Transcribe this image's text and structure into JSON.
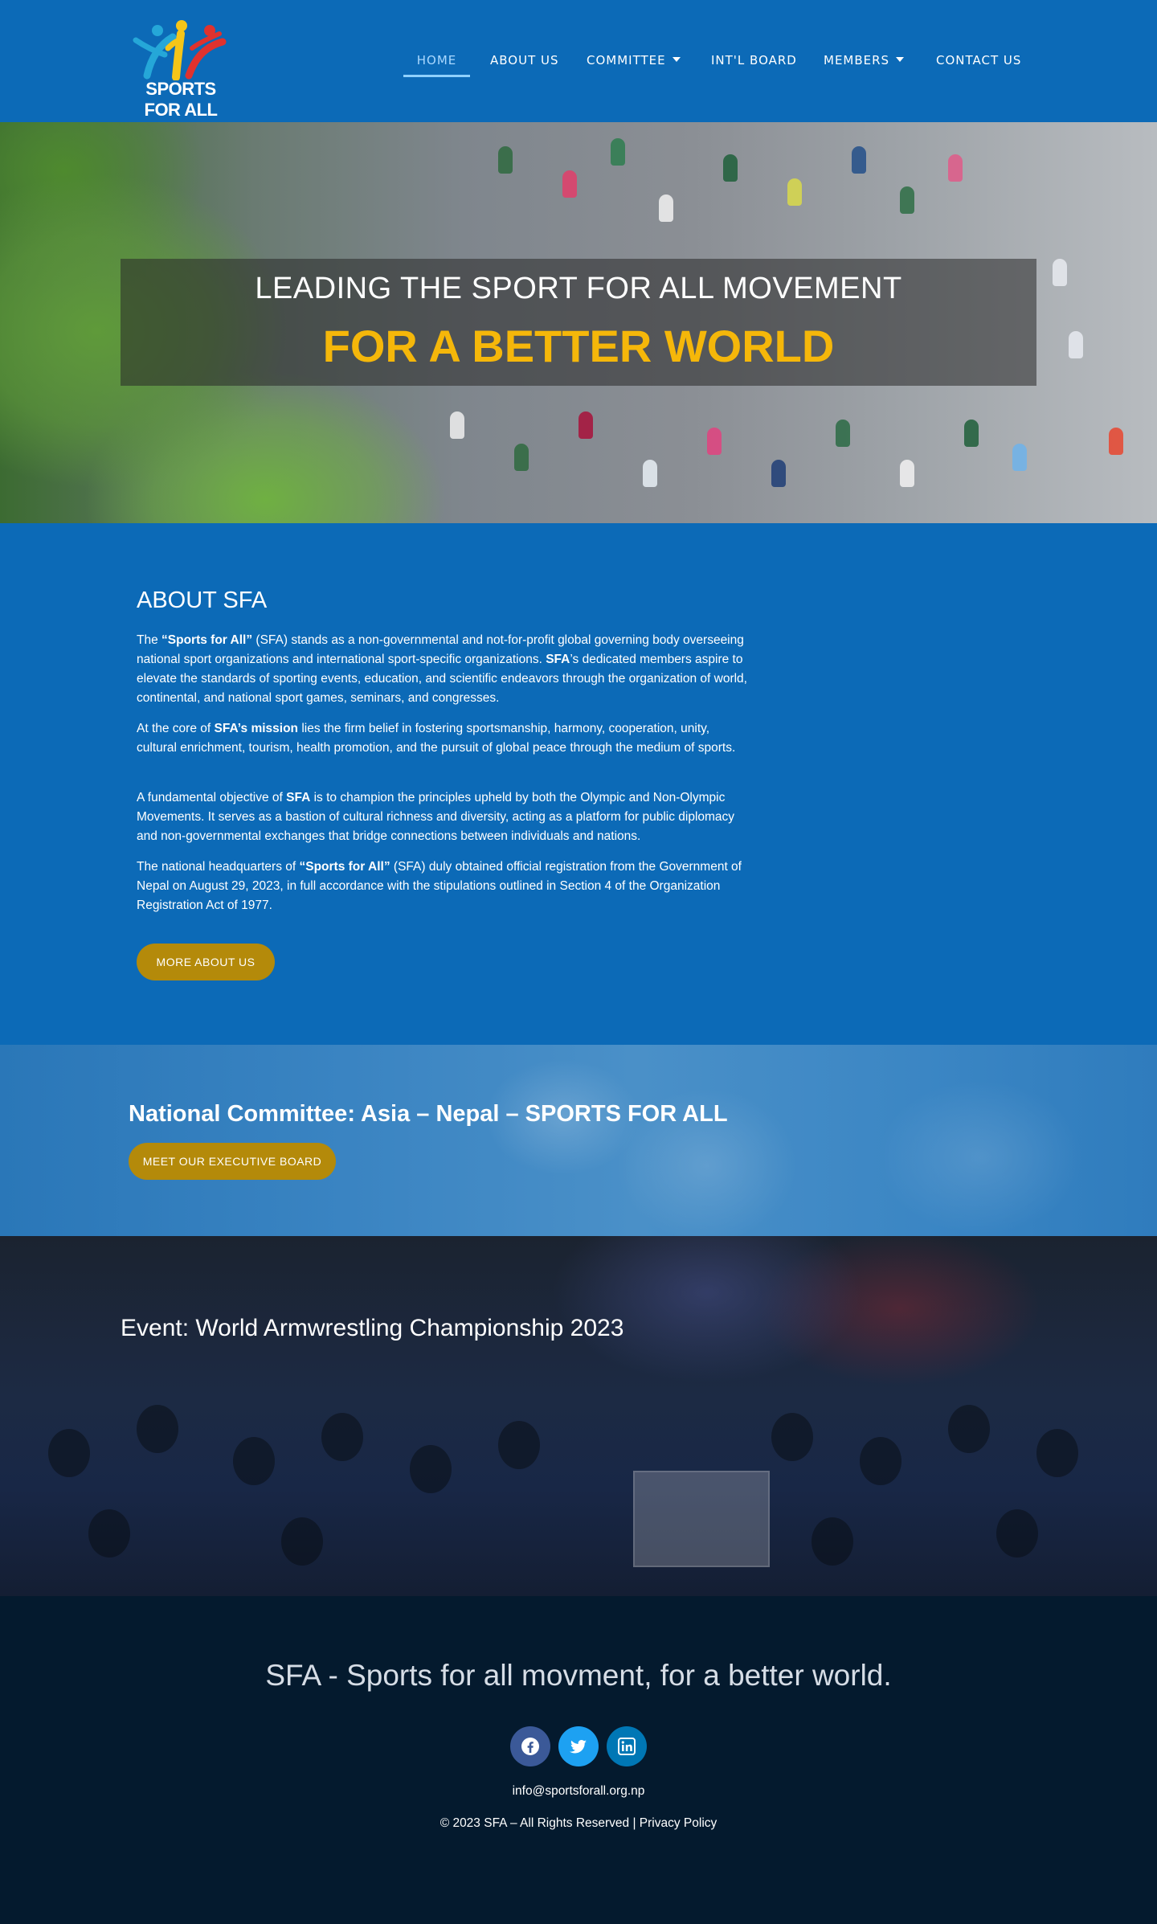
{
  "header": {
    "logo_text": "SPORTS FOR ALL",
    "nav": [
      {
        "label": "HOME",
        "active": true
      },
      {
        "label": "ABOUT US"
      },
      {
        "label": "COMMITTEE",
        "dropdown": true
      },
      {
        "label": "INT'L BOARD"
      },
      {
        "label": "MEMBERS",
        "dropdown": true
      },
      {
        "label": "CONTACT US"
      }
    ]
  },
  "hero": {
    "title": "LEADING THE SPORT FOR ALL MOVEMENT",
    "subtitle": "FOR A BETTER WORLD"
  },
  "about": {
    "heading": "ABOUT SFA",
    "paragraphs": [
      {
        "pre": "The ",
        "bold1": "“Sports for All”",
        "mid": " (SFA) stands as a non-governmental and not-for-profit global governing body overseeing national sport organizations and international sport-specific organizations. ",
        "bold2": "SFA",
        "post": "’s dedicated members aspire to elevate the standards of sporting events, education, and scientific endeavors through the organization of world, continental, and national sport games, seminars, and congresses."
      },
      {
        "pre": "At the core of ",
        "bold1": "SFA’s mission",
        "post": " lies the firm belief in fostering sportsmanship, harmony, cooperation, unity, cultural enrichment, tourism, health promotion, and the pursuit of global peace through the medium of sports."
      },
      {
        "pre": "A fundamental objective of ",
        "bold1": "SFA",
        "post": " is to champion the principles upheld by both the Olympic and Non-Olympic Movements. It serves as a bastion of cultural richness and diversity, acting as a platform for public diplomacy and non-governmental exchanges that bridge connections between individuals and nations."
      },
      {
        "pre": "The national headquarters of ",
        "bold1": "“Sports for All”",
        "post": " (SFA) duly obtained official registration from the Government of Nepal on August 29, 2023, in full accordance with the stipulations outlined in Section 4 of the Organization Registration Act of 1977."
      }
    ],
    "button_label": "MORE ABOUT US"
  },
  "committee": {
    "heading": "National Committee: Asia – Nepal – SPORTS FOR ALL",
    "button_label": "MEET OUR EXECUTIVE BOARD"
  },
  "event": {
    "heading": "Event: World Armwrestling Championship 2023"
  },
  "footer": {
    "tagline": "SFA - Sports for all movment, for a better world.",
    "social": [
      {
        "icon": "facebook-icon",
        "color": "#3b5998"
      },
      {
        "icon": "twitter-icon",
        "color": "#1da1f2"
      },
      {
        "icon": "linkedin-icon",
        "color": "#0077b5"
      }
    ],
    "email": "info@sportsforall.org.np",
    "copyright": "© 2023 SFA – All Rights Reserved | ",
    "privacy_label": "Privacy Policy"
  },
  "colors": {
    "brand_blue": "#0c6ab7",
    "gold": "#f5b70a",
    "button_gold": "#b48a0a",
    "footer_bg": "#041a2e"
  }
}
